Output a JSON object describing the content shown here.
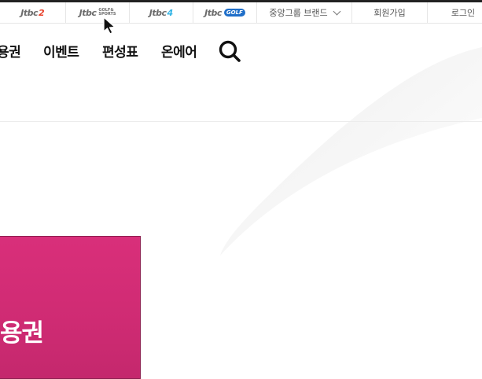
{
  "topbar": {
    "channels": [
      {
        "name": "jtbc2",
        "prefix": "Jtbc",
        "suffix": "2",
        "suffix_color": "#e8412c"
      },
      {
        "name": "jtbc-golf-sports",
        "prefix": "Jtbc",
        "suffix": "GOLF& SPORTS"
      },
      {
        "name": "jtbc4",
        "prefix": "Jtbc",
        "suffix": "4",
        "suffix_color": "#36b5e5"
      },
      {
        "name": "jtbc-golf",
        "prefix": "Jtbc",
        "suffix": "GOLF"
      }
    ],
    "brand_menu": "중앙그룹 브랜드",
    "signup": "회원가입",
    "login": "로그인"
  },
  "nav": {
    "items": [
      "용권",
      "이벤트",
      "편성표",
      "온에어"
    ]
  },
  "icons": {
    "search": "search-icon",
    "brand_dropdown": "chevron-down-icon",
    "cursor": "mouse-cursor-icon"
  },
  "banner": {
    "title": "용권",
    "color": "#d62e77"
  }
}
